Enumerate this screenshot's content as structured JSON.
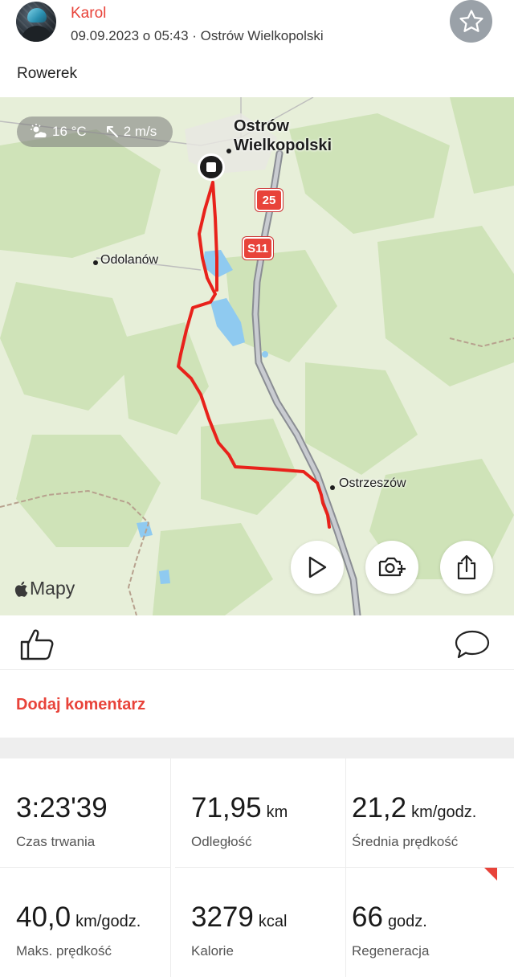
{
  "header": {
    "user_name": "Karol",
    "meta": "09.09.2023 o 05:43 · Ostrów Wielkopolski",
    "favorite_icon": "star-icon"
  },
  "activity": {
    "title": "Rowerek"
  },
  "map": {
    "weather": {
      "temperature": "16 °C",
      "wind": "2 m/s"
    },
    "places": {
      "city": "Ostrów\nWielkopolski",
      "town_west": "Odolanów",
      "town_south": "Ostrzeszów"
    },
    "road_shields": [
      "25",
      "S11"
    ],
    "brand": "Mapy",
    "buttons": [
      "play-icon",
      "camera-add-icon",
      "share-icon"
    ],
    "route_color": "#e8221b"
  },
  "actions": {
    "like_icon": "thumbs-up-icon",
    "comment_icon": "comment-icon"
  },
  "add_comment_label": "Dodaj komentarz",
  "stats": [
    {
      "value": "3:23'39",
      "unit": "",
      "label": "Czas trwania"
    },
    {
      "value": "71,95",
      "unit": "km",
      "label": "Odległość"
    },
    {
      "value": "21,2",
      "unit": "km/godz.",
      "label": "Średnia prędkość"
    },
    {
      "value": "40,0",
      "unit": "km/godz.",
      "label": "Maks. prędkość"
    },
    {
      "value": "3279",
      "unit": "kcal",
      "label": "Kalorie"
    },
    {
      "value": "66",
      "unit": "godz.",
      "label": "Regeneracja"
    }
  ],
  "colors": {
    "accent": "#e8433a",
    "forest": "#cfe3b8",
    "meadow": "#e7efd9",
    "water": "#8fcaf0"
  }
}
